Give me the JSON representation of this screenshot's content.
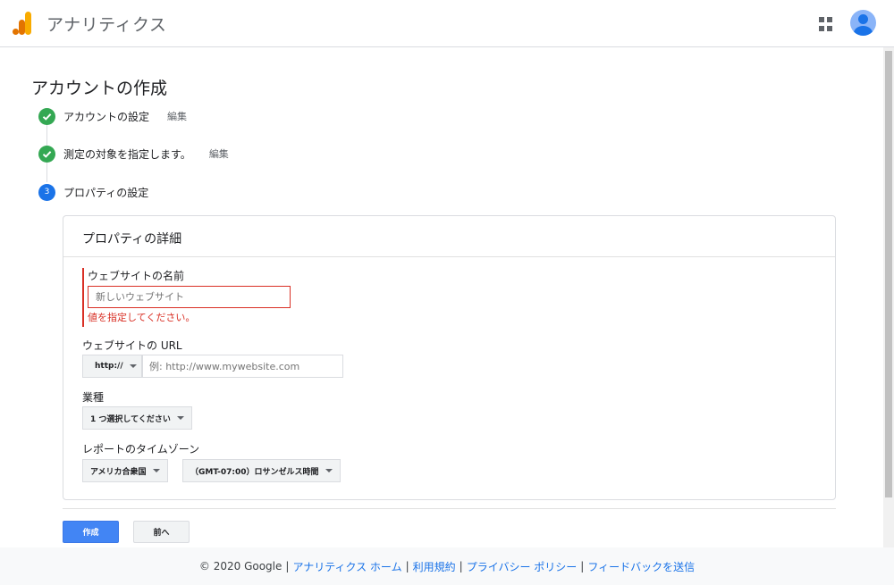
{
  "header": {
    "app_title": "アナリティクス",
    "logo_colors": [
      "#e37400",
      "#f9ab00"
    ],
    "apps_icon": "apps-grid-icon",
    "avatar_icon": "account-avatar-icon"
  },
  "page": {
    "title": "アカウントの作成"
  },
  "steps": [
    {
      "label": "アカウントの設定",
      "edit": "編集",
      "status": "done",
      "icon": "check-icon"
    },
    {
      "label": "測定の対象を指定します。",
      "edit": "編集",
      "status": "done",
      "icon": "check-icon"
    },
    {
      "label": "プロパティの設定",
      "number": "3",
      "status": "current"
    }
  ],
  "property": {
    "card_title": "プロパティの詳細",
    "website_name_label": "ウェブサイトの名前",
    "website_name_placeholder": "新しいウェブサイト",
    "website_name_error": "値を指定してください。",
    "website_url_label": "ウェブサイトの URL",
    "protocol": "http://",
    "url_placeholder": "例: http://www.mywebsite.com",
    "industry_label": "業種",
    "industry_value": "1 つ選択してください",
    "timezone_label": "レポートのタイムゾーン",
    "country_value": "アメリカ合衆国",
    "timezone_value": "（GMT-07:00）ロサンゼルス時間"
  },
  "actions": {
    "create_label": "作成",
    "back_label": "前へ"
  },
  "footer": {
    "copyright": "© 2020 Google",
    "link_home": "アナリティクス ホーム",
    "link_terms": "利用規約",
    "link_privacy": "プライバシー ポリシー",
    "link_feedback": "フィードバックを送信",
    "separator": "|"
  },
  "colors": {
    "accent": "#1a73e8",
    "success": "#34a853",
    "error": "#d93025",
    "primary_button": "#4285f4"
  }
}
